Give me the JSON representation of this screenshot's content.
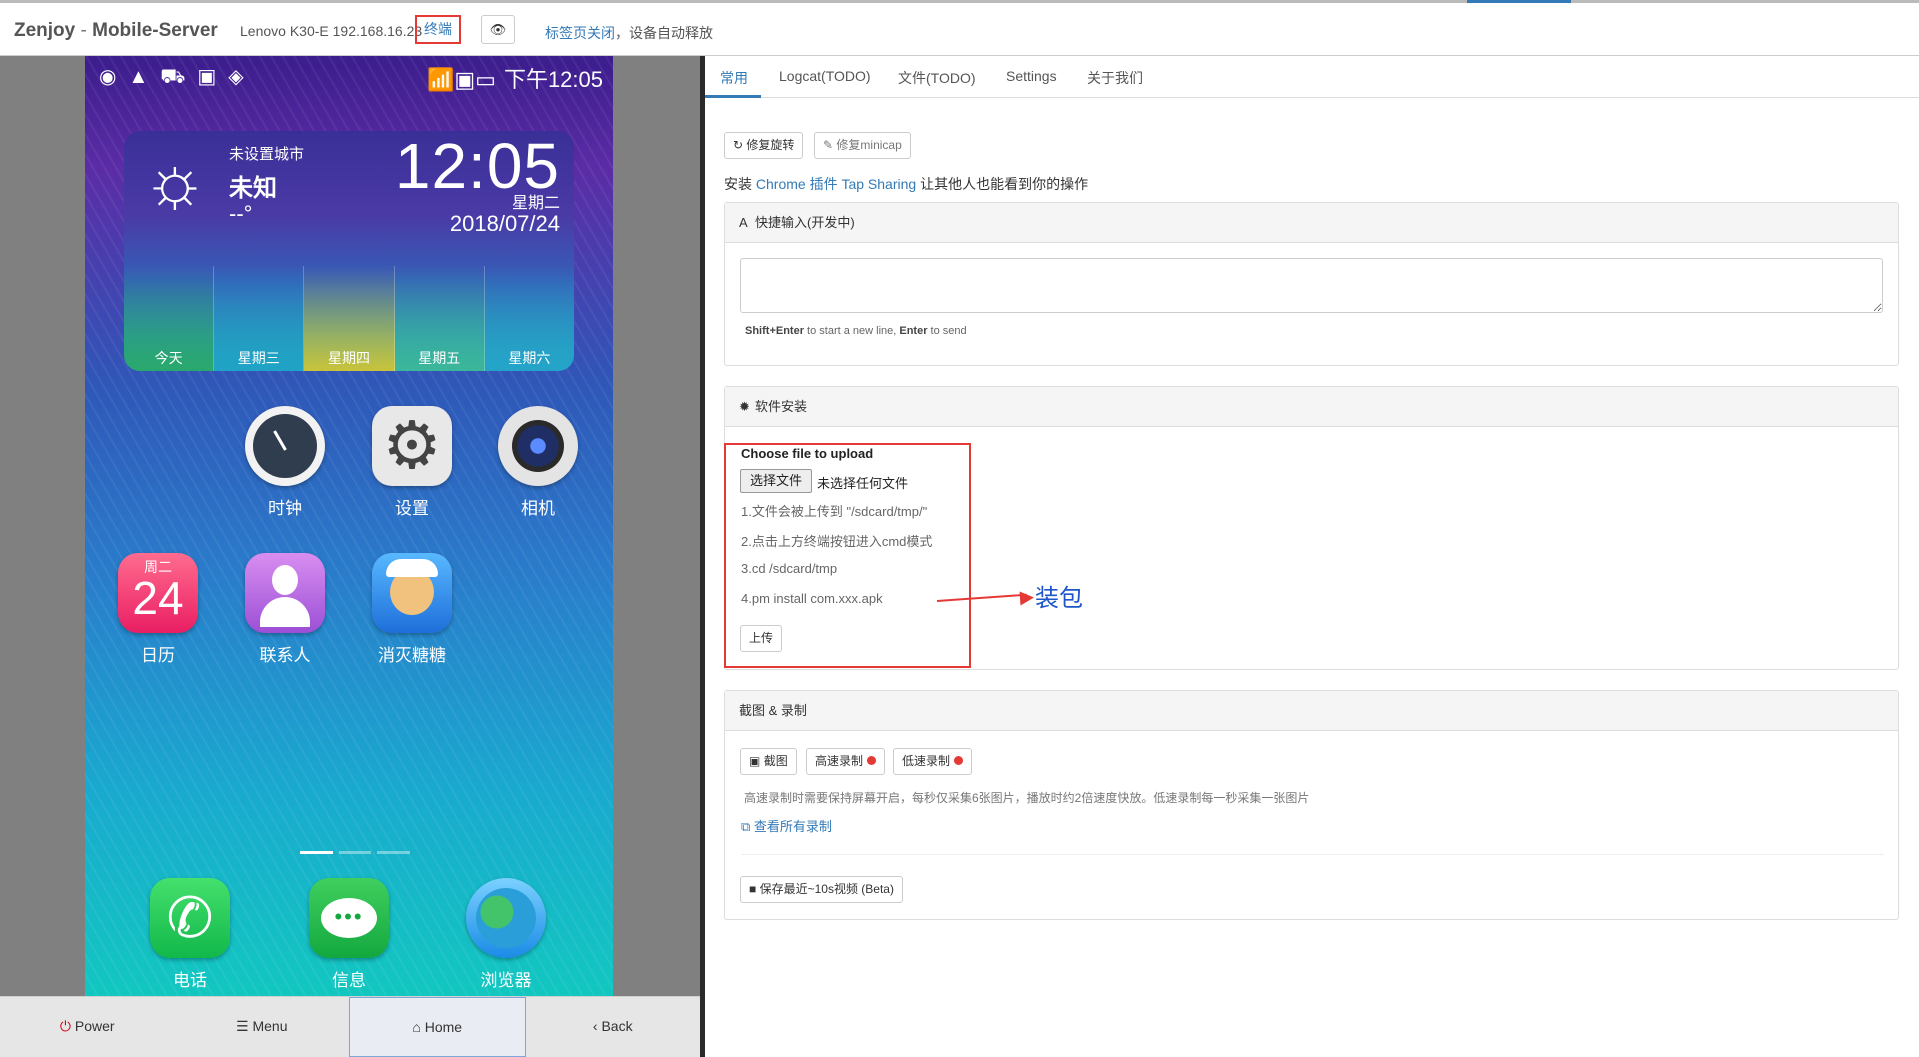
{
  "header": {
    "brand": "Zenjoy",
    "brand_sep": " - ",
    "brand_sub": "Mobile-Server",
    "device_info": "Lenovo K30-E 192.168.16.23",
    "terminal_label": "终端",
    "eye_icon": "eye-icon",
    "release_link": "标签页关闭",
    "release_text": "，设备自动释放"
  },
  "phone": {
    "status_left": "◉▲⛟▣◈",
    "status_right": "📶▣▭",
    "status_time": "下午12:05",
    "weather": {
      "city": "未设置城市",
      "condition": "未知",
      "temp": "--°",
      "clock": "12:05",
      "weekday": "星期二",
      "date": "2018/07/24",
      "days": [
        "今天",
        "星期三",
        "星期四",
        "星期五",
        "星期六"
      ]
    },
    "apps_row1": [
      "时钟",
      "设置",
      "相机"
    ],
    "apps_row2": [
      "日历",
      "联系人",
      "消灭糖糖"
    ],
    "calendar": {
      "weekday": "周二",
      "day": "24"
    },
    "dock": [
      "电话",
      "信息",
      "浏览器"
    ]
  },
  "nav": {
    "power": "Power",
    "menu": "Menu",
    "home": "Home",
    "back": "Back"
  },
  "tabs": [
    "常用",
    "Logcat(TODO)",
    "文件(TODO)",
    "Settings",
    "关于我们"
  ],
  "toolbar": {
    "fix_rotation": "修复旋转",
    "fix_minicap": "修复minicap"
  },
  "install_line": {
    "prefix": "安装 ",
    "chrome": "Chrome",
    "plugin": " 插件 ",
    "tap_sharing": "Tap Sharing",
    "suffix": " 让其他人也能看到你的操作"
  },
  "quick_input": {
    "title": "快捷输入(开发中)",
    "value": "",
    "hint_key1": "Shift+Enter",
    "hint_mid": " to start a new line, ",
    "hint_key2": "Enter",
    "hint_end": " to send"
  },
  "install_panel": {
    "title": "软件安装",
    "choose_title": "Choose file to upload",
    "file_button": "选择文件",
    "file_none": "未选择任何文件",
    "steps": [
      "1.文件会被上传到 \"/sdcard/tmp/\"",
      "2.点击上方终端按钮进入cmd模式",
      "3.cd /sdcard/tmp",
      "4.pm install com.xxx.apk"
    ],
    "upload_button": "上传",
    "annotation": "装包"
  },
  "capture_panel": {
    "title": "截图 & 录制",
    "screenshot": "截图",
    "hq_record": "高速录制",
    "lq_record": "低速录制",
    "hint": "高速录制时需要保持屏幕开启，每秒仅采集6张图片，播放时约2倍速度快放。低速录制每一秒采集一张图片",
    "view_all": "查看所有录制",
    "save_video": "保存最近~10s视频 (Beta)"
  },
  "colors": {
    "accent": "#337ab7",
    "annotation_red": "#e53935",
    "annotation_blue": "#1e56c9",
    "record_dot": "#e53935"
  }
}
